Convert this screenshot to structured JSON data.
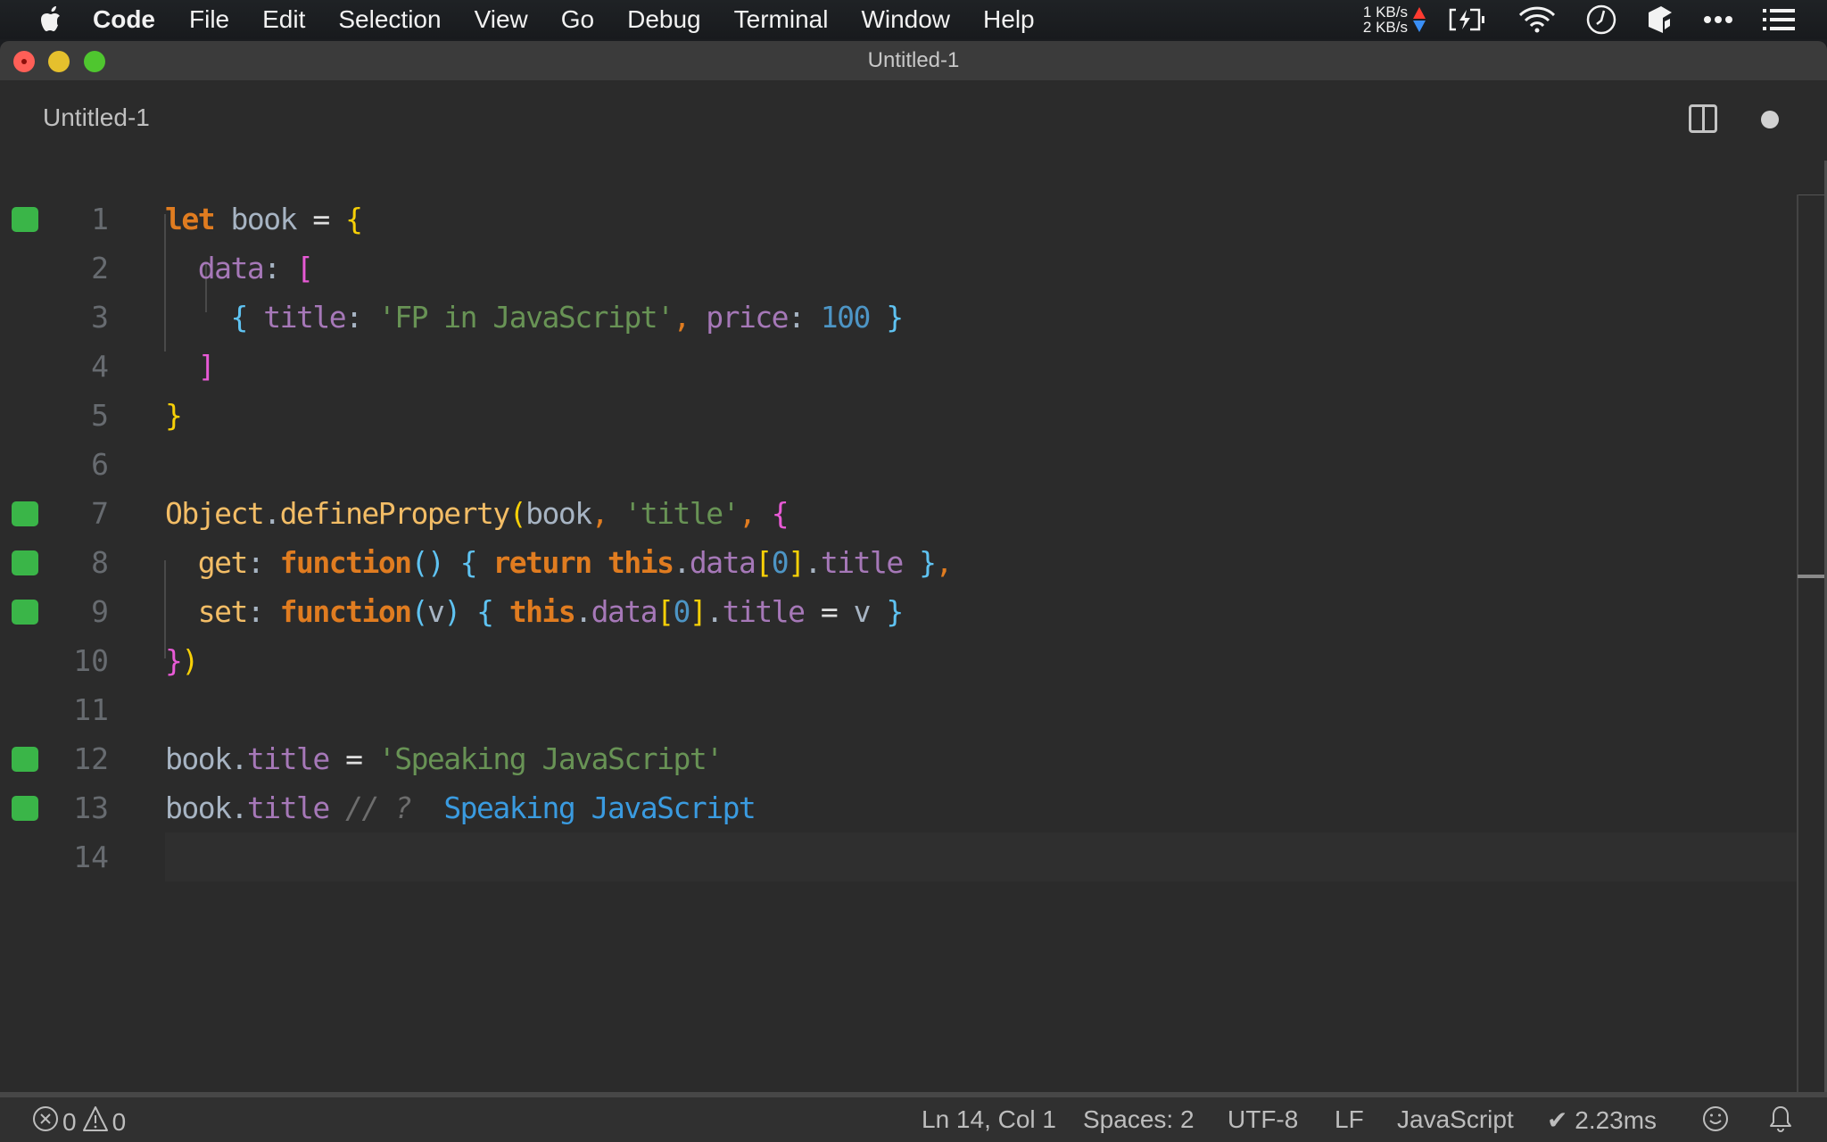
{
  "menubar": {
    "app_name": "Code",
    "items": [
      "File",
      "Edit",
      "Selection",
      "View",
      "Go",
      "Debug",
      "Terminal",
      "Window",
      "Help"
    ],
    "net_up": "1 KB/s",
    "net_down": "2 KB/s",
    "tray_icons": [
      "battery-charging-icon",
      "wifi-icon",
      "clock-icon",
      "dropbox-like-icon",
      "more-icon",
      "list-icon"
    ]
  },
  "window": {
    "title": "Untitled-1",
    "tab_label": "Untitled-1",
    "unsaved": true
  },
  "editor": {
    "language": "JavaScript",
    "lines": [
      {
        "n": "1",
        "marker": true
      },
      {
        "n": "2",
        "marker": false
      },
      {
        "n": "3",
        "marker": false
      },
      {
        "n": "4",
        "marker": false
      },
      {
        "n": "5",
        "marker": false
      },
      {
        "n": "6",
        "marker": false
      },
      {
        "n": "7",
        "marker": true
      },
      {
        "n": "8",
        "marker": true
      },
      {
        "n": "9",
        "marker": true
      },
      {
        "n": "10",
        "marker": false
      },
      {
        "n": "11",
        "marker": false
      },
      {
        "n": "12",
        "marker": true
      },
      {
        "n": "13",
        "marker": true
      },
      {
        "n": "14",
        "marker": false
      }
    ],
    "tokens": {
      "let": "let",
      "book": "book",
      "eq": "=",
      "lbrace": "{",
      "rbrace": "}",
      "data": "data",
      "colon": ":",
      "lbrack": "[",
      "rbrack": "]",
      "title": "title",
      "fp_string": "'FP in JavaScript'",
      "comma": ",",
      "price": "price",
      "price_value": "100",
      "object": "Object",
      "dot": ".",
      "defineProperty": "defineProperty",
      "lparen": "(",
      "rparen": ")",
      "title_string": "'title'",
      "get": "get",
      "set": "set",
      "function": "function",
      "return": "return",
      "this": "this",
      "zero": "0",
      "v": "v",
      "speaking_string": "'Speaking JavaScript'",
      "comment": "// ?",
      "inline_result": "Speaking JavaScript"
    },
    "marker_color": "#3ab548"
  },
  "statusbar": {
    "errors": "0",
    "warnings": "0",
    "position": "Ln 14, Col 1",
    "indent": "Spaces: 2",
    "encoding": "UTF-8",
    "eol": "LF",
    "language": "JavaScript",
    "timing": "✔ 2.23ms"
  }
}
